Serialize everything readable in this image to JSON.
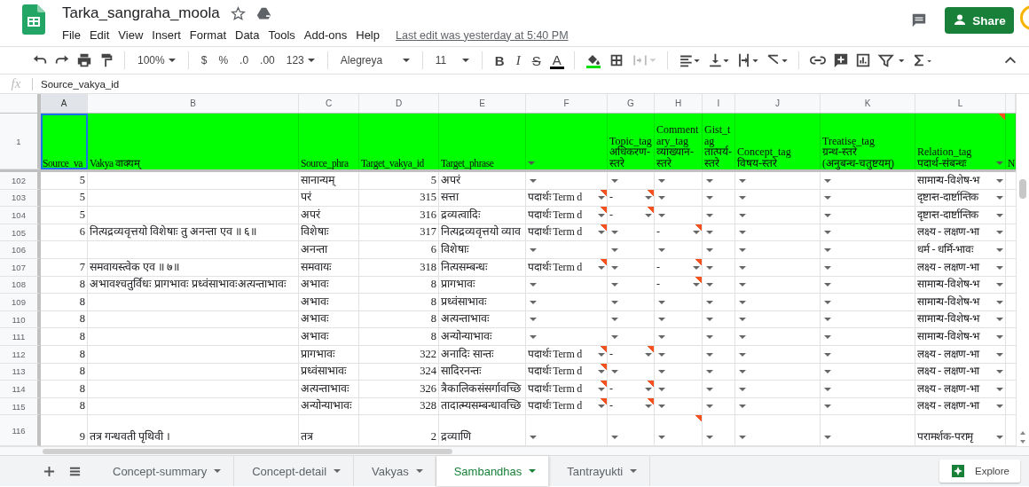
{
  "app": {
    "title": "Tarka_sangraha_moola",
    "menu": [
      "File",
      "Edit",
      "View",
      "Insert",
      "Format",
      "Data",
      "Tools",
      "Add-ons",
      "Help"
    ],
    "last_edit": "Last edit was yesterday at 5:40 PM",
    "share": "Share"
  },
  "toolbar": {
    "zoom": "100%",
    "currency": "$",
    "percent": "%",
    "decrease_decimals": ".0",
    "increase_decimals": ".00",
    "number_format": "123",
    "font": "Alegreya",
    "font_size": "11",
    "bold": "B",
    "italic": "I",
    "strikethrough": "S",
    "text_color": "A"
  },
  "formula_bar": {
    "fx": "fx",
    "value": "Source_vakya_id"
  },
  "sheet": {
    "header_row": "1",
    "columns": [
      {
        "letter": "A",
        "header": "Source_va",
        "kind": "number",
        "selected": true,
        "header_dropdown": false,
        "header_note": false
      },
      {
        "letter": "B",
        "header": "Vakya वाक्यम्",
        "kind": "text",
        "selected": false,
        "header_dropdown": false,
        "header_note": false
      },
      {
        "letter": "C",
        "header": "Source_phra",
        "kind": "text",
        "selected": false,
        "header_dropdown": false,
        "header_note": false
      },
      {
        "letter": "D",
        "header": "Target_vakya_id",
        "kind": "number",
        "selected": false,
        "header_dropdown": false,
        "header_note": false
      },
      {
        "letter": "E",
        "header": "Target_phrase",
        "kind": "text",
        "selected": false,
        "header_dropdown": false,
        "header_note": false
      },
      {
        "letter": "F",
        "kind": "dropdown",
        "selected": false,
        "header_dropdown": true,
        "header_note": false
      },
      {
        "letter": "G",
        "header": "Topic_tag\nअधिकरण-स्तरे",
        "kind": "dropdown",
        "selected": false,
        "header_dropdown": false,
        "header_note": false
      },
      {
        "letter": "H",
        "header": "Commentary_tag\nव्याख्यान-स्तरे",
        "kind": "dropdown",
        "selected": false,
        "header_dropdown": false,
        "header_note": false
      },
      {
        "letter": "I",
        "header": "Gist_tag\nतात्पर्य-स्तरे",
        "kind": "dropdown",
        "selected": false,
        "header_dropdown": false,
        "header_note": false
      },
      {
        "letter": "J",
        "header": "Concept_tag\nविषय-स्तरे",
        "kind": "dropdown",
        "selected": false,
        "header_dropdown": false,
        "header_note": false
      },
      {
        "letter": "K",
        "header": "Treatise_tag\nग्रन्थ-स्तरे\n(अनुबन्ध-चतुष्टयम्)",
        "kind": "dropdown",
        "selected": false,
        "header_dropdown": false,
        "header_note": false
      },
      {
        "letter": "L",
        "header": "Relation_tag\nपदार्थ-संबन्धः",
        "kind": "dropdown",
        "selected": false,
        "header_dropdown": true,
        "header_note": true
      },
      {
        "header": "N",
        "kind": "text",
        "selected": false,
        "header_dropdown": false,
        "header_note": false
      }
    ],
    "rows": [
      {
        "number": "102",
        "cells": [
          {
            "text": "5",
            "note": false
          },
          {
            "note": false
          },
          {
            "text": "सानान्यम्",
            "note": false
          },
          {
            "text": "5",
            "note": false
          },
          {
            "text": "अपरं",
            "note": false
          },
          {
            "note": false
          },
          {
            "note": false
          },
          {
            "note": false
          },
          {
            "note": false
          },
          {
            "note": false
          },
          {
            "note": false
          },
          {
            "text": "सामान्य-विशेष-भ",
            "note": false
          }
        ]
      },
      {
        "number": "103",
        "cells": [
          {
            "text": "5",
            "note": false
          },
          {
            "note": false
          },
          {
            "text": "परं",
            "note": false
          },
          {
            "text": "315",
            "note": false
          },
          {
            "text": "सत्ता",
            "note": false
          },
          {
            "text": "पदार्थः Term d",
            "note": true
          },
          {
            "text": "-",
            "note": true
          },
          {
            "note": false
          },
          {
            "note": false
          },
          {
            "note": false
          },
          {
            "note": false
          },
          {
            "text": "दृष्टान्त-दार्ष्टान्तिक",
            "note": false
          }
        ]
      },
      {
        "number": "104",
        "cells": [
          {
            "text": "5",
            "note": false
          },
          {
            "note": false
          },
          {
            "text": "अपरं",
            "note": false
          },
          {
            "text": "316",
            "note": false
          },
          {
            "text": "द्रव्यत्वादिः",
            "note": false
          },
          {
            "text": "पदार्थः Term d",
            "note": true
          },
          {
            "text": "-",
            "note": true
          },
          {
            "note": false
          },
          {
            "note": false
          },
          {
            "note": false
          },
          {
            "note": false
          },
          {
            "text": "दृष्टान्त-दार्ष्टान्तिक",
            "note": false
          }
        ]
      },
      {
        "number": "105",
        "cells": [
          {
            "text": "6",
            "note": false
          },
          {
            "text": "नित्यद्रव्यवृत्तयो विशेषाः तु अनन्ता एव ॥ ६॥",
            "note": false
          },
          {
            "text": "विशेषाः",
            "note": false
          },
          {
            "text": "317",
            "note": false
          },
          {
            "text": "नित्यद्रव्यवृत्तयो व्याव",
            "note": false
          },
          {
            "text": "पदार्थः Term d",
            "note": true
          },
          {
            "note": false
          },
          {
            "text": "-",
            "note": true
          },
          {
            "note": false
          },
          {
            "note": false
          },
          {
            "note": false
          },
          {
            "text": "लक्ष्य - लक्षण-भा",
            "note": false
          }
        ]
      },
      {
        "number": "106",
        "cells": [
          {
            "note": false
          },
          {
            "note": false
          },
          {
            "text": "अनन्ता",
            "note": false
          },
          {
            "text": "6",
            "note": false
          },
          {
            "text": "विशेषाः",
            "note": false
          },
          {
            "note": false
          },
          {
            "note": false
          },
          {
            "note": false
          },
          {
            "note": false
          },
          {
            "note": false
          },
          {
            "note": false
          },
          {
            "text": "धर्म - धर्मि-भावः",
            "note": false
          }
        ]
      },
      {
        "number": "107",
        "cells": [
          {
            "text": "7",
            "note": false
          },
          {
            "text": "समवायस्त्वेक एव ॥ ७॥",
            "note": false
          },
          {
            "text": "समवायः",
            "note": false
          },
          {
            "text": "318",
            "note": false
          },
          {
            "text": "नित्यसम्बन्धः",
            "note": false
          },
          {
            "text": "पदार्थः Term d",
            "note": true
          },
          {
            "note": false
          },
          {
            "text": "-",
            "note": true
          },
          {
            "note": false
          },
          {
            "note": false
          },
          {
            "note": false
          },
          {
            "text": "लक्ष्य - लक्षण-भा",
            "note": false
          }
        ]
      },
      {
        "number": "108",
        "cells": [
          {
            "text": "8",
            "note": false
          },
          {
            "text": "अभावश्चतुर्विधः प्रागभावः प्रध्वंसाभावःअत्यन्ताभावः",
            "note": false
          },
          {
            "text": "अभावः",
            "note": false
          },
          {
            "text": "8",
            "note": false
          },
          {
            "text": "प्रागभावः",
            "note": false
          },
          {
            "note": false
          },
          {
            "note": false
          },
          {
            "text": "-",
            "note": true
          },
          {
            "note": false
          },
          {
            "note": false
          },
          {
            "note": false
          },
          {
            "text": "सामान्य-विशेष-भ",
            "note": false
          }
        ]
      },
      {
        "number": "109",
        "cells": [
          {
            "text": "8",
            "note": false
          },
          {
            "note": false
          },
          {
            "text": "अभावः",
            "note": false
          },
          {
            "text": "8",
            "note": false
          },
          {
            "text": "प्रध्वंसाभावः",
            "note": false
          },
          {
            "note": false
          },
          {
            "note": false
          },
          {
            "note": false
          },
          {
            "note": false
          },
          {
            "note": false
          },
          {
            "note": false
          },
          {
            "text": "सामान्य-विशेष-भ",
            "note": false
          }
        ]
      },
      {
        "number": "110",
        "cells": [
          {
            "text": "8",
            "note": false
          },
          {
            "note": false
          },
          {
            "text": "अभावः",
            "note": false
          },
          {
            "text": "8",
            "note": false
          },
          {
            "text": "अत्यन्ताभावः",
            "note": false
          },
          {
            "note": false
          },
          {
            "note": false
          },
          {
            "note": false
          },
          {
            "note": false
          },
          {
            "note": false
          },
          {
            "note": false
          },
          {
            "text": "सामान्य-विशेष-भ",
            "note": false
          }
        ]
      },
      {
        "number": "111",
        "cells": [
          {
            "text": "8",
            "note": false
          },
          {
            "note": false
          },
          {
            "text": "अभावः",
            "note": false
          },
          {
            "text": "8",
            "note": false
          },
          {
            "text": "अन्योन्याभावः",
            "note": false
          },
          {
            "note": false
          },
          {
            "note": false
          },
          {
            "note": false
          },
          {
            "note": false
          },
          {
            "note": false
          },
          {
            "note": false
          },
          {
            "text": "सामान्य-विशेष-भ",
            "note": false
          }
        ]
      },
      {
        "number": "112",
        "cells": [
          {
            "text": "8",
            "note": false
          },
          {
            "note": false
          },
          {
            "text": "प्रागभावः",
            "note": false
          },
          {
            "text": "322",
            "note": false
          },
          {
            "text": "अनादिः सान्तः",
            "note": false
          },
          {
            "text": "पदार्थः Term d",
            "note": true
          },
          {
            "text": "-",
            "note": true
          },
          {
            "note": false
          },
          {
            "note": false
          },
          {
            "note": false
          },
          {
            "note": false
          },
          {
            "text": "लक्ष्य - लक्षण-भा",
            "note": false
          }
        ]
      },
      {
        "number": "113",
        "cells": [
          {
            "text": "8",
            "note": false
          },
          {
            "note": false
          },
          {
            "text": "प्रध्वंसाभावः",
            "note": false
          },
          {
            "text": "324",
            "note": false
          },
          {
            "text": "सादिरनन्तः",
            "note": false
          },
          {
            "text": "पदार्थः Term d",
            "note": true
          },
          {
            "note": false
          },
          {
            "note": false
          },
          {
            "note": false
          },
          {
            "note": false
          },
          {
            "note": false
          },
          {
            "text": "लक्ष्य - लक्षण-भा",
            "note": false
          }
        ]
      },
      {
        "number": "114",
        "cells": [
          {
            "text": "8",
            "note": false
          },
          {
            "note": false
          },
          {
            "text": "अत्यन्ताभावः",
            "note": false
          },
          {
            "text": "326",
            "note": false
          },
          {
            "text": "त्रैकालिकसंसर्गावच्छि",
            "note": false
          },
          {
            "text": "पदार्थः Term d",
            "note": true
          },
          {
            "text": "-",
            "note": true
          },
          {
            "note": false
          },
          {
            "note": false
          },
          {
            "note": false
          },
          {
            "note": false
          },
          {
            "text": "लक्ष्य - लक्षण-भा",
            "note": false
          }
        ]
      },
      {
        "number": "115",
        "cells": [
          {
            "text": "8",
            "note": false
          },
          {
            "note": false
          },
          {
            "text": "अन्योन्याभावः",
            "note": false
          },
          {
            "text": "328",
            "note": false
          },
          {
            "text": "तादात्म्यसम्बन्धावच्छि",
            "note": false
          },
          {
            "text": "पदार्थः Term d",
            "note": true
          },
          {
            "text": "-",
            "note": true
          },
          {
            "note": false
          },
          {
            "note": false
          },
          {
            "note": false
          },
          {
            "note": false
          },
          {
            "text": "लक्ष्य - लक्षण-भा",
            "note": false
          }
        ]
      },
      {
        "number": "116",
        "cells": [
          {
            "text": "9",
            "note": false
          },
          {
            "text": "तत्र गन्धवती पृथिवी ।",
            "note": false
          },
          {
            "text": "तत्र",
            "note": false
          },
          {
            "text": "2",
            "note": false
          },
          {
            "text": "द्रव्याणि",
            "note": false
          },
          {
            "note": false
          },
          {
            "note": false
          },
          {
            "note": true
          },
          {
            "note": false
          },
          {
            "note": false
          },
          {
            "note": false
          },
          {
            "text": "परामर्शक-परामृ",
            "note": false
          }
        ]
      }
    ]
  },
  "sheet_tabs": [
    {
      "label": "Concept-summary",
      "selected": false
    },
    {
      "label": "Concept-detail",
      "selected": false
    },
    {
      "label": "Vakyas",
      "selected": false
    },
    {
      "label": "Sambandhas",
      "selected": true
    },
    {
      "label": "Tantrayukti",
      "selected": false
    }
  ],
  "explore": "Explore"
}
